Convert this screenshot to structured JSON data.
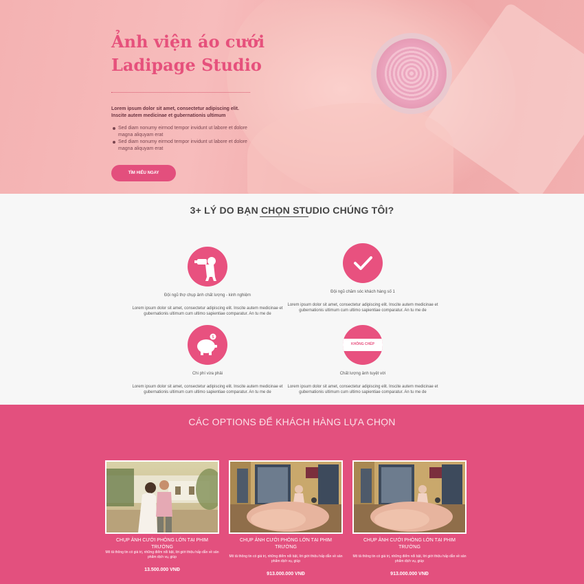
{
  "hero": {
    "title_line1": "Ảnh viện áo cưới",
    "title_line2": "Ladipage Studio",
    "lead": "Lorem ipsum dolor sit amet, consectetur adipiscing elit. Inscite autem medicinae et gubernationis ultimum",
    "bullets": [
      "Sed diam nonumy eirmod tempor invidunt ut labore et dolore magna aliquyam erat",
      "Sed diam nonumy eirmod tempor invidunt ut labore et dolore magna aliquyam erat"
    ],
    "cta_label": "TÌM HIỂU NGAY"
  },
  "reasons": {
    "title": "3+ LÝ DO BẠN CHỌN STUDIO CHÚNG TÔI?",
    "items": [
      {
        "icon": "photographer-icon",
        "title": "Đội ngũ thợ chụp ảnh chất lượng - kinh nghiệm",
        "desc": "Lorem ipsum dolor sit amet, consectetur adipiscing elit. Inscite autem medicinae et gubernationis ultimum cum ultimo sapientiae comparatur. An tu me de"
      },
      {
        "icon": "checkmark-icon",
        "title": "Đội ngũ chăm sóc khách hàng số 1",
        "desc": "Lorem ipsum dolor sit amet, consectetur adipiscing elit. Inscite autem medicinae et gubernationis ultimum cum ultimo sapientiae comparatur. An tu me de"
      },
      {
        "icon": "piggy-bank-icon",
        "title": "Chi phí vừa phải",
        "desc": "Lorem ipsum dolor sit amet, consectetur adipiscing elit. Inscite autem medicinae et gubernationis ultimum cum ultimo sapientiae comparatur. An tu me de"
      },
      {
        "icon": "no-copy-badge-icon",
        "badge": "KHÔNG CHÉP",
        "title": "Chất lượng ảnh tuyệt vời",
        "desc": "Lorem ipsum dolor sit amet, consectetur adipiscing elit. Inscite autem medicinae et gubernationis ultimum cum ultimo sapientiae comparatur. An tu me de"
      }
    ]
  },
  "options": {
    "title": "CÁC OPTIONS ĐỂ KHÁCH HÀNG LỰA CHỌN",
    "cards": [
      {
        "title": "CHỤP ẢNH CƯỚI PHÒNG LỚN TẠI PHIM TRƯỜNG",
        "desc": "Mô tả thông tin có giá trị, những điểm nổi bật, lời giới thiệu hấp dẫn về sản phẩm dịch vụ, giúp",
        "price": "13.500.000 VNĐ"
      },
      {
        "title": "CHỤP ẢNH CƯỚI PHÒNG LỚN TẠI PHIM TRƯỜNG",
        "desc": "Mô tả thông tin có giá trị, những điểm nổi bật, lời giới thiệu hấp dẫn về sản phẩm dịch vụ, giúp",
        "price": "913.000.000 VNĐ"
      },
      {
        "title": "CHỤP ẢNH CƯỚI PHÒNG LỚN TẠI PHIM TRƯỜNG",
        "desc": "Mô tả thông tin có giá trị, những điểm nổi bật, lời giới thiệu hấp dẫn về sản phẩm dịch vụ, giúp",
        "price": "913.000.000 VNĐ"
      }
    ]
  },
  "colors": {
    "accent": "#e8517f",
    "hero_bg": "#f4b2b2",
    "options_bg": "#e3507e"
  }
}
